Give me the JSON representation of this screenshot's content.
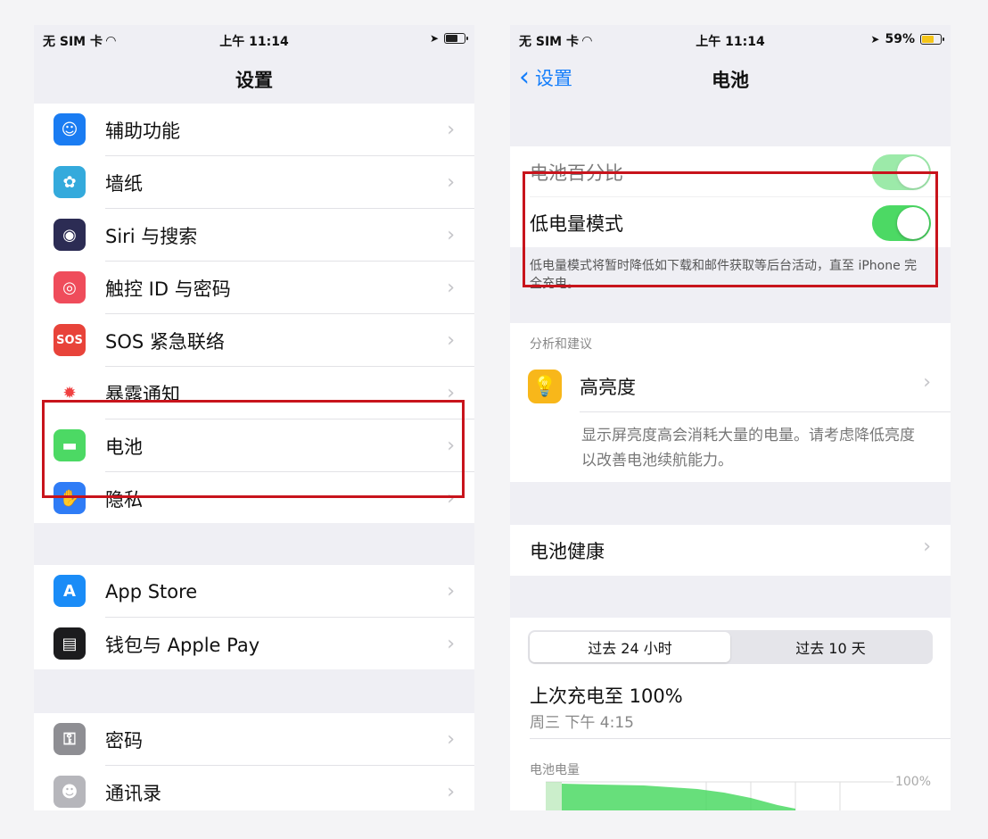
{
  "left": {
    "status": {
      "carrier": "无 SIM 卡",
      "time": "上午 11:14"
    },
    "title": "设置",
    "group1": [
      {
        "label": "辅助功能",
        "icon": "accessibility-icon",
        "color": "#1a7cf2",
        "glyph": "☺"
      },
      {
        "label": "墙纸",
        "icon": "wallpaper-icon",
        "color": "#34aadc",
        "glyph": "✿"
      },
      {
        "label": "Siri 与搜索",
        "icon": "siri-icon",
        "color": "#2c2c54",
        "glyph": "◉"
      },
      {
        "label": "触控 ID 与密码",
        "icon": "touch-id-icon",
        "color": "#ef4c5b",
        "glyph": "◎"
      },
      {
        "label": "SOS 紧急联络",
        "icon": "sos-icon",
        "color": "#e8433a",
        "glyph": "SOS"
      },
      {
        "label": "暴露通知",
        "icon": "exposure-icon",
        "color": "#ffffff",
        "glyph": "✹"
      },
      {
        "label": "电池",
        "icon": "battery-app-icon",
        "color": "#4cd964",
        "glyph": "▬"
      },
      {
        "label": "隐私",
        "icon": "privacy-hand-icon",
        "color": "#2f7cf6",
        "glyph": "✋"
      }
    ],
    "group2": [
      {
        "label": "App Store",
        "icon": "app-store-icon",
        "color": "#1a8cf7",
        "glyph": "A"
      },
      {
        "label": "钱包与 Apple Pay",
        "icon": "wallet-icon",
        "color": "#1c1c1e",
        "glyph": "▤"
      }
    ],
    "group3": [
      {
        "label": "密码",
        "icon": "key-icon",
        "color": "#8e8e93",
        "glyph": "⚿"
      },
      {
        "label": "通讯录",
        "icon": "contacts-icon",
        "color": "#b6b6bb",
        "glyph": "☻"
      }
    ]
  },
  "right": {
    "status": {
      "carrier": "无 SIM 卡",
      "time": "上午 11:14",
      "battery": "59%"
    },
    "back_label": "设置",
    "title": "电池",
    "battery_percentage_label": "电池百分比",
    "low_power_label": "低电量模式",
    "low_power_note": "低电量模式将暂时降低如下载和邮件获取等后台活动，直至 iPhone 完全充电。",
    "insights_header": "分析和建议",
    "brightness_label": "高亮度",
    "brightness_note": "显示屏亮度高会消耗大量的电量。请考虑降低亮度以改善电池续航能力。",
    "battery_health_label": "电池健康",
    "segment": {
      "left": "过去 24 小时",
      "right": "过去 10 天"
    },
    "last_charge": "上次充电至 100%",
    "last_charge_time": "周三 下午 4:15",
    "battery_level_label": "电池电量",
    "chart_max_label": "100%",
    "colors": {
      "accent": "#147efb",
      "toggle_on": "#4cd964",
      "highlight": "#c8141c"
    }
  }
}
